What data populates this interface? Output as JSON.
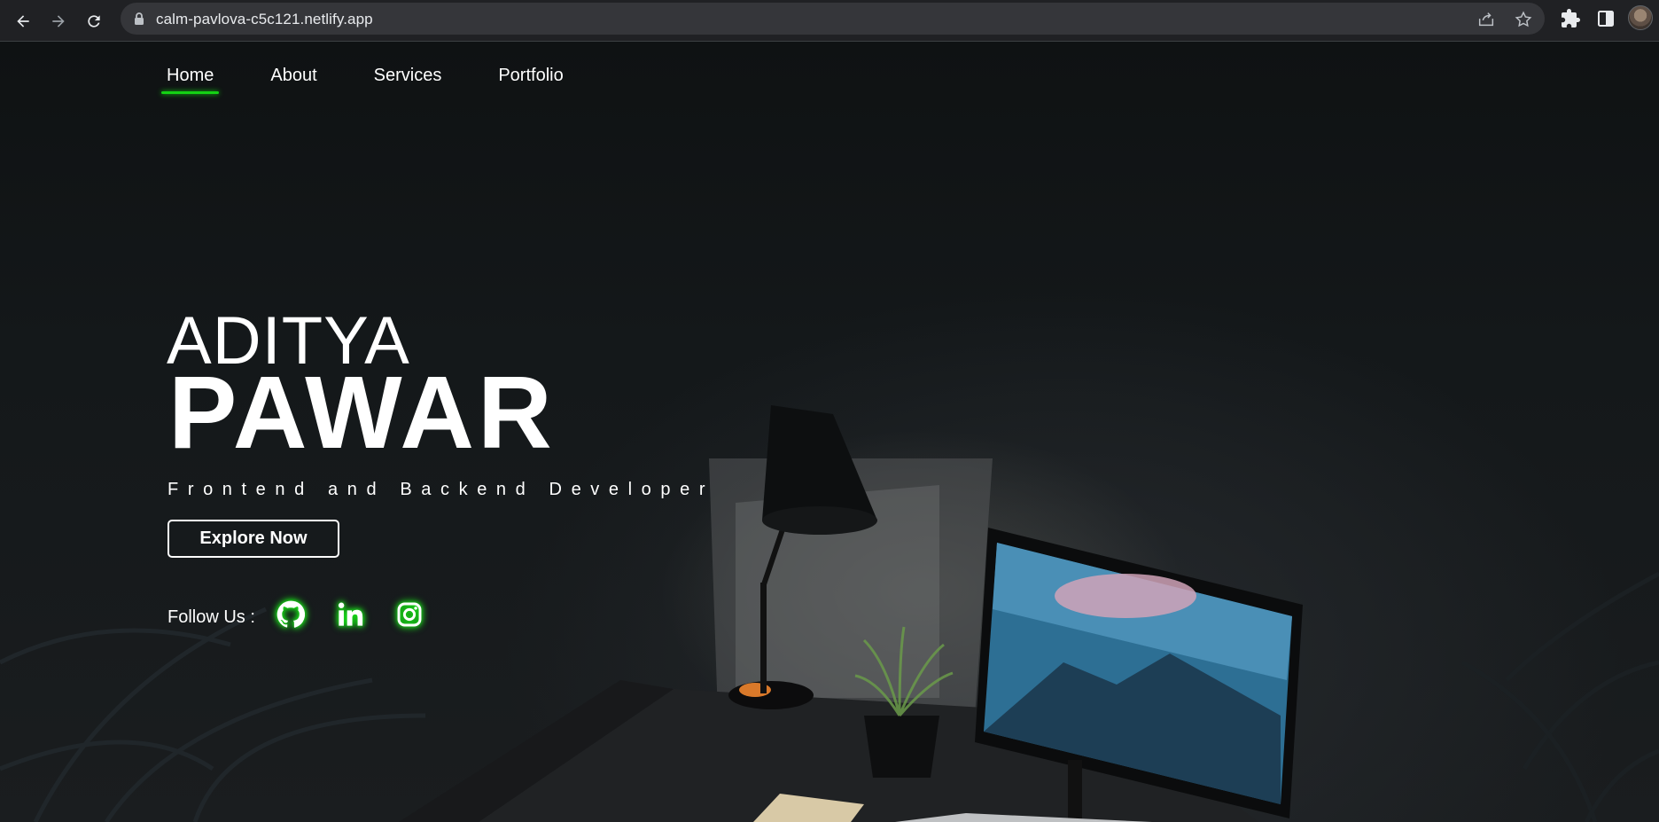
{
  "browser": {
    "url": "calm-pavlova-c5c121.netlify.app",
    "icons": {
      "back": "arrow-left-icon",
      "forward": "arrow-right-icon",
      "reload": "reload-icon",
      "lock": "lock-icon",
      "share": "share-icon",
      "bookmark": "star-icon",
      "extensions": "puzzle-icon",
      "side_panel": "side-panel-icon",
      "profile": "avatar"
    }
  },
  "nav": {
    "items": [
      {
        "label": "Home",
        "active": true
      },
      {
        "label": "About",
        "active": false
      },
      {
        "label": "Services",
        "active": false
      },
      {
        "label": "Portfolio",
        "active": false
      }
    ]
  },
  "hero": {
    "first_name": "ADITYA",
    "last_name": "PAWAR",
    "role": "Frontend and Backend Developer",
    "cta_label": "Explore Now",
    "follow_label": "Follow Us :",
    "socials": [
      {
        "name": "github-icon"
      },
      {
        "name": "linkedin-icon"
      },
      {
        "name": "instagram-icon"
      }
    ]
  },
  "colors": {
    "accent_green": "#14d114",
    "text": "#ffffff",
    "background": "#111314",
    "chrome_bg": "#202124",
    "omnibox_bg": "#35363a"
  }
}
